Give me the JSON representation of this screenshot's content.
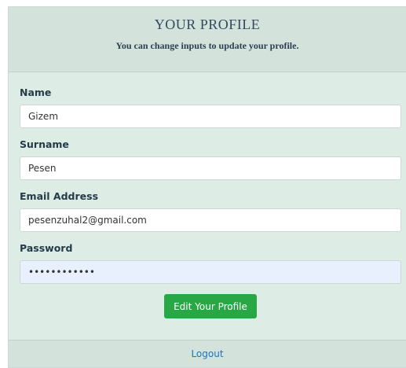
{
  "header": {
    "title": "YOUR PROFILE",
    "subtitle": "You can change inputs to update your profile."
  },
  "form": {
    "name": {
      "label": "Name",
      "value": "Gizem"
    },
    "surname": {
      "label": "Surname",
      "value": "Pesen"
    },
    "email": {
      "label": "Email Address",
      "value": "pesenzuhal2@gmail.com"
    },
    "password": {
      "label": "Password",
      "value": "••••••••••••"
    },
    "submit_label": "Edit Your Profile"
  },
  "footer": {
    "logout_label": "Logout"
  },
  "colors": {
    "primary_button": "#28a745",
    "link": "#1e73be",
    "card_bg": "#deece6"
  }
}
